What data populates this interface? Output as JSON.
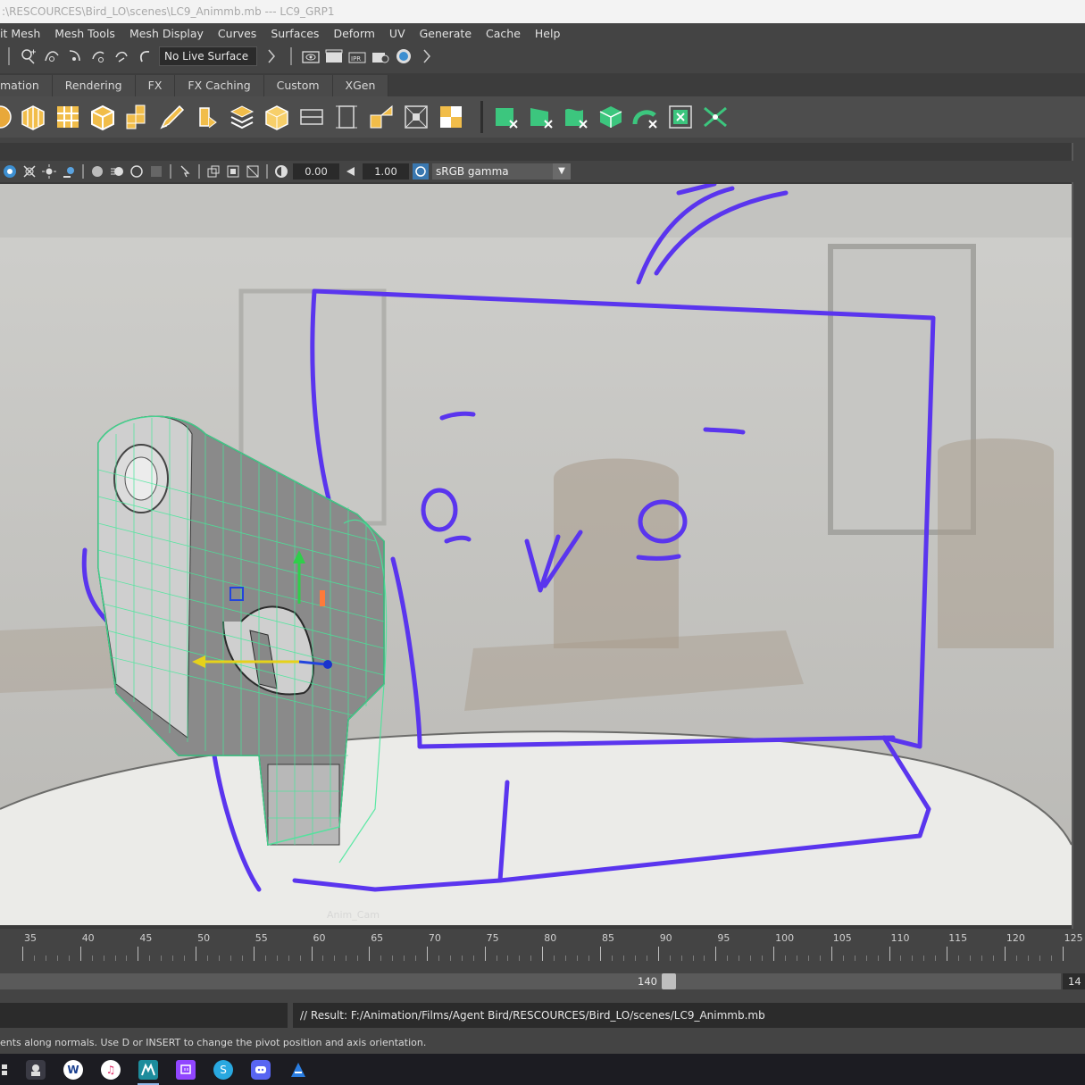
{
  "window": {
    "title": ":\\RESCOURCES\\Bird_LO\\scenes\\LC9_Animmb.mb  ---  LC9_GRP1"
  },
  "menu": [
    "it Mesh",
    "Mesh Tools",
    "Mesh Display",
    "Curves",
    "Surfaces",
    "Deform",
    "UV",
    "Generate",
    "Cache",
    "Help"
  ],
  "status_line": {
    "live_surface": "No Live Surface",
    "icons": [
      "snap-to-grid-icon",
      "snap-to-curve-icon",
      "snap-to-point-icon",
      "snap-to-view-plane-icon",
      "make-live-icon",
      "render-view-icon",
      "render-frame-icon",
      "ipr-render-icon",
      "render-settings-icon",
      "hypershade-icon"
    ]
  },
  "shelf_tabs": [
    "mation",
    "Rendering",
    "FX",
    "FX Caching",
    "Custom",
    "XGen"
  ],
  "shelf_icons": [
    "sphere-icon",
    "cube-icon",
    "grid-plane-icon",
    "box-icon",
    "stacked-cubes-icon",
    "pen-icon",
    "bevel-icon",
    "layers-icon",
    "unfold-box-icon",
    "align-icon",
    "dimension-icon",
    "scale-box-icon",
    "snap-box-icon",
    "split-cubes-icon"
  ],
  "shelf_icons_green": [
    "green-cube-icon",
    "green-bend-icon",
    "green-wave-icon",
    "green-lattice-icon",
    "green-twist-icon",
    "green-grid-icon",
    "green-cross-icon"
  ],
  "viewport_toolbar": {
    "exposure": "0.00",
    "gamma": "1.00",
    "color_management": "sRGB gamma"
  },
  "viewport": {
    "camera_label": "Anim_Cam"
  },
  "timeline": {
    "ticks": [
      "35",
      "40",
      "45",
      "50",
      "55",
      "60",
      "65",
      "70",
      "75",
      "80",
      "85",
      "90",
      "95",
      "100",
      "105",
      "110",
      "115",
      "120",
      "125"
    ]
  },
  "range_slider": {
    "current_end": "140",
    "end_field": "14"
  },
  "command_line": {
    "result": "// Result: F:/Animation/Films/Agent Bird/RESCOURCES/Bird_LO/scenes/LC9_Animmb.mb"
  },
  "help_line": "ents along normals. Use D or INSERT to change the pivot position and axis orientation.",
  "taskbar": [
    "start-icon",
    "explorer-icon",
    "word-icon",
    "itunes-icon",
    "maya-icon",
    "twitch-icon",
    "skype-icon",
    "discord-icon",
    "vlc-icon"
  ]
}
